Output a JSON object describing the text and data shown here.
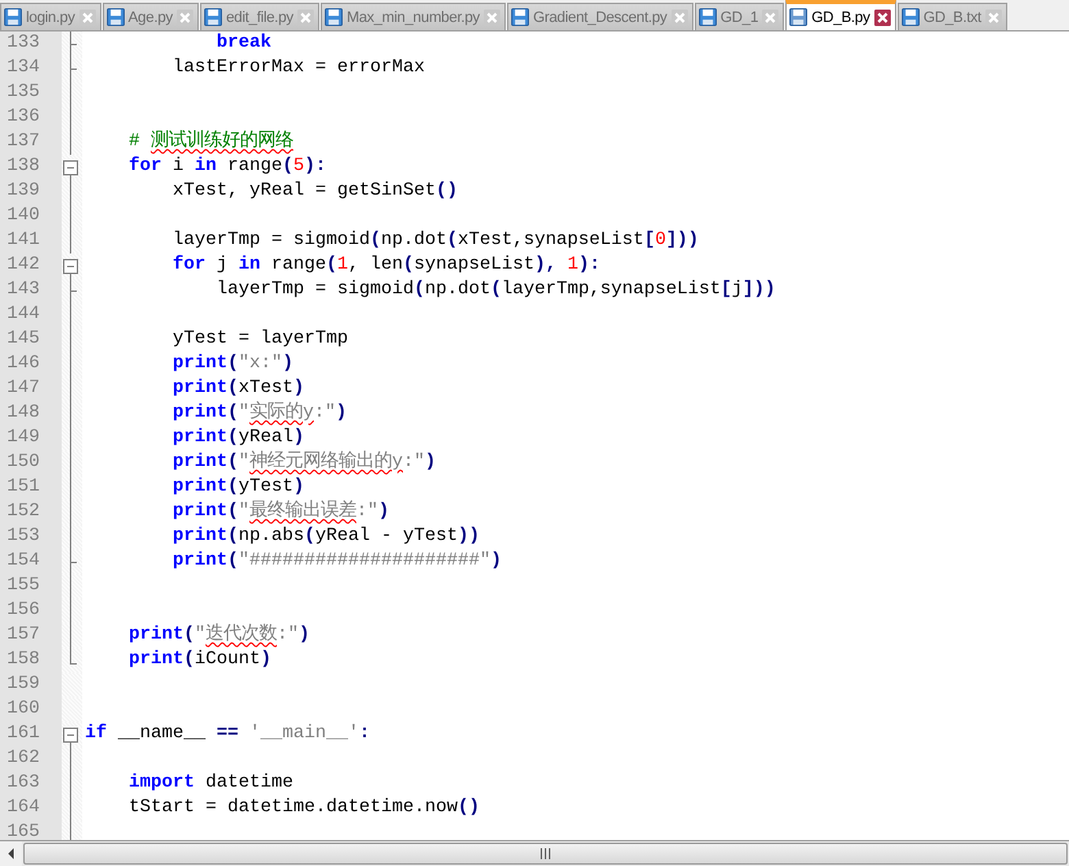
{
  "tabs": [
    {
      "label": "login.py",
      "selected": false
    },
    {
      "label": "Age.py",
      "selected": false
    },
    {
      "label": "edit_file.py",
      "selected": false
    },
    {
      "label": "Max_min_number.py",
      "selected": false
    },
    {
      "label": "Gradient_Descent.py",
      "selected": false
    },
    {
      "label": "GD_1",
      "selected": false
    },
    {
      "label": "GD_B.py",
      "selected": true
    },
    {
      "label": "GD_B.txt",
      "selected": false
    }
  ],
  "editor": {
    "lines": [
      {
        "number": "133",
        "kind": "branch",
        "tokens": [
          {
            "kind": "kw",
            "text": "            break"
          }
        ]
      },
      {
        "number": "134",
        "kind": "branch",
        "tokens": [
          {
            "kind": "id",
            "text": "        lastErrorMax = errorMax"
          }
        ]
      },
      {
        "number": "135",
        "kind": "line"
      },
      {
        "number": "136",
        "kind": "line"
      },
      {
        "number": "137",
        "kind": "line",
        "tokens": [
          {
            "kind": "cmt",
            "text": "    # "
          },
          {
            "kind": "cmt",
            "text": "测试训练好的网络",
            "squiggle": true
          }
        ]
      },
      {
        "number": "138",
        "kind": "open",
        "tokens": [
          {
            "kind": "kw",
            "text": "    for"
          },
          {
            "kind": "id",
            "text": " i "
          },
          {
            "kind": "kw",
            "text": "in"
          },
          {
            "kind": "id",
            "text": " range"
          },
          {
            "kind": "op",
            "text": "("
          },
          {
            "kind": "num",
            "text": "5"
          },
          {
            "kind": "op",
            "text": "):"
          }
        ]
      },
      {
        "number": "139",
        "kind": "line",
        "tokens": [
          {
            "kind": "id",
            "text": "        xTest, yReal = getSinSet"
          },
          {
            "kind": "op",
            "text": "()"
          }
        ]
      },
      {
        "number": "140",
        "kind": "line"
      },
      {
        "number": "141",
        "kind": "line",
        "tokens": [
          {
            "kind": "id",
            "text": "        layerTmp = sigmoid"
          },
          {
            "kind": "op",
            "text": "("
          },
          {
            "kind": "id",
            "text": "np.dot"
          },
          {
            "kind": "op",
            "text": "("
          },
          {
            "kind": "id",
            "text": "xTest,synapseList"
          },
          {
            "kind": "op",
            "text": "["
          },
          {
            "kind": "num",
            "text": "0"
          },
          {
            "kind": "op",
            "text": "]))"
          }
        ]
      },
      {
        "number": "142",
        "kind": "open",
        "tokens": [
          {
            "kind": "kw",
            "text": "        for"
          },
          {
            "kind": "id",
            "text": " j "
          },
          {
            "kind": "kw",
            "text": "in"
          },
          {
            "kind": "id",
            "text": " range"
          },
          {
            "kind": "op",
            "text": "("
          },
          {
            "kind": "num",
            "text": "1"
          },
          {
            "kind": "id",
            "text": ", len"
          },
          {
            "kind": "op",
            "text": "("
          },
          {
            "kind": "id",
            "text": "synapseList"
          },
          {
            "kind": "op",
            "text": "),"
          },
          {
            "kind": "num",
            "text": " 1"
          },
          {
            "kind": "op",
            "text": "):"
          }
        ]
      },
      {
        "number": "143",
        "kind": "branch",
        "tokens": [
          {
            "kind": "id",
            "text": "            layerTmp = sigmoid"
          },
          {
            "kind": "op",
            "text": "("
          },
          {
            "kind": "id",
            "text": "np.dot"
          },
          {
            "kind": "op",
            "text": "("
          },
          {
            "kind": "id",
            "text": "layerTmp,synapseList"
          },
          {
            "kind": "op",
            "text": "["
          },
          {
            "kind": "id",
            "text": "j"
          },
          {
            "kind": "op",
            "text": "]))"
          }
        ]
      },
      {
        "number": "144",
        "kind": "line"
      },
      {
        "number": "145",
        "kind": "line",
        "tokens": [
          {
            "kind": "id",
            "text": "        yTest = layerTmp"
          }
        ]
      },
      {
        "number": "146",
        "kind": "line",
        "tokens": [
          {
            "kind": "kw",
            "text": "        print"
          },
          {
            "kind": "op",
            "text": "("
          },
          {
            "kind": "str",
            "text": "\"x:\""
          },
          {
            "kind": "op",
            "text": ")"
          }
        ]
      },
      {
        "number": "147",
        "kind": "line",
        "tokens": [
          {
            "kind": "kw",
            "text": "        print"
          },
          {
            "kind": "op",
            "text": "("
          },
          {
            "kind": "id",
            "text": "xTest"
          },
          {
            "kind": "op",
            "text": ")"
          }
        ]
      },
      {
        "number": "148",
        "kind": "line",
        "tokens": [
          {
            "kind": "kw",
            "text": "        print"
          },
          {
            "kind": "op",
            "text": "("
          },
          {
            "kind": "str",
            "text": "\""
          },
          {
            "kind": "str",
            "text": "实际的y",
            "squiggle": true
          },
          {
            "kind": "str",
            "text": ":\""
          },
          {
            "kind": "op",
            "text": ")"
          }
        ]
      },
      {
        "number": "149",
        "kind": "line",
        "tokens": [
          {
            "kind": "kw",
            "text": "        print"
          },
          {
            "kind": "op",
            "text": "("
          },
          {
            "kind": "id",
            "text": "yReal"
          },
          {
            "kind": "op",
            "text": ")"
          }
        ]
      },
      {
        "number": "150",
        "kind": "line",
        "tokens": [
          {
            "kind": "kw",
            "text": "        print"
          },
          {
            "kind": "op",
            "text": "("
          },
          {
            "kind": "str",
            "text": "\""
          },
          {
            "kind": "str",
            "text": "神经元网络输出的y",
            "squiggle": true
          },
          {
            "kind": "str",
            "text": ":\""
          },
          {
            "kind": "op",
            "text": ")"
          }
        ]
      },
      {
        "number": "151",
        "kind": "line",
        "tokens": [
          {
            "kind": "kw",
            "text": "        print"
          },
          {
            "kind": "op",
            "text": "("
          },
          {
            "kind": "id",
            "text": "yTest"
          },
          {
            "kind": "op",
            "text": ")"
          }
        ]
      },
      {
        "number": "152",
        "kind": "line",
        "tokens": [
          {
            "kind": "kw",
            "text": "        print"
          },
          {
            "kind": "op",
            "text": "("
          },
          {
            "kind": "str",
            "text": "\""
          },
          {
            "kind": "str",
            "text": "最终输出误差",
            "squiggle": true
          },
          {
            "kind": "str",
            "text": ":\""
          },
          {
            "kind": "op",
            "text": ")"
          }
        ]
      },
      {
        "number": "153",
        "kind": "line",
        "tokens": [
          {
            "kind": "kw",
            "text": "        print"
          },
          {
            "kind": "op",
            "text": "("
          },
          {
            "kind": "id",
            "text": "np.abs"
          },
          {
            "kind": "op",
            "text": "("
          },
          {
            "kind": "id",
            "text": "yReal - yTest"
          },
          {
            "kind": "op",
            "text": "))"
          }
        ]
      },
      {
        "number": "154",
        "kind": "branch",
        "tokens": [
          {
            "kind": "kw",
            "text": "        print"
          },
          {
            "kind": "op",
            "text": "("
          },
          {
            "kind": "str",
            "text": "\"#####################\""
          },
          {
            "kind": "op",
            "text": ")"
          }
        ]
      },
      {
        "number": "155",
        "kind": "line"
      },
      {
        "number": "156",
        "kind": "line"
      },
      {
        "number": "157",
        "kind": "line",
        "tokens": [
          {
            "kind": "kw",
            "text": "    print"
          },
          {
            "kind": "op",
            "text": "("
          },
          {
            "kind": "str",
            "text": "\""
          },
          {
            "kind": "str",
            "text": "迭代次数",
            "squiggle": true
          },
          {
            "kind": "str",
            "text": ":\""
          },
          {
            "kind": "op",
            "text": ")"
          }
        ]
      },
      {
        "number": "158",
        "kind": "end",
        "tokens": [
          {
            "kind": "kw",
            "text": "    print"
          },
          {
            "kind": "op",
            "text": "("
          },
          {
            "kind": "id",
            "text": "iCount"
          },
          {
            "kind": "op",
            "text": ")"
          }
        ]
      },
      {
        "number": "159",
        "kind": "none"
      },
      {
        "number": "160",
        "kind": "none"
      },
      {
        "number": "161",
        "kind": "open",
        "tokens": [
          {
            "kind": "kw",
            "text": "if"
          },
          {
            "kind": "id",
            "text": " __name__ "
          },
          {
            "kind": "op",
            "text": "=="
          },
          {
            "kind": "str",
            "text": " '__main__'"
          },
          {
            "kind": "op",
            "text": ":"
          }
        ]
      },
      {
        "number": "162",
        "kind": "line"
      },
      {
        "number": "163",
        "kind": "line",
        "tokens": [
          {
            "kind": "kw",
            "text": "    import"
          },
          {
            "kind": "id",
            "text": " datetime"
          }
        ]
      },
      {
        "number": "164",
        "kind": "line",
        "tokens": [
          {
            "kind": "id",
            "text": "    tStart = datetime.datetime.now"
          },
          {
            "kind": "op",
            "text": "()"
          }
        ]
      },
      {
        "number": "165",
        "kind": "line"
      }
    ]
  }
}
